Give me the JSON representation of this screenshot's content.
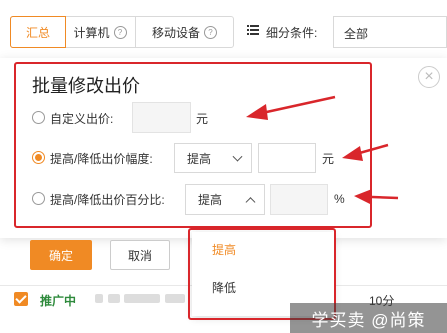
{
  "tabs": [
    {
      "label": "汇总",
      "active": true,
      "help": false
    },
    {
      "label": "计算机",
      "active": false,
      "help": true
    },
    {
      "label": "移动设备",
      "active": false,
      "help": true
    }
  ],
  "filter": {
    "label": "细分条件:",
    "value": "全部"
  },
  "dialog": {
    "title": "批量修改出价",
    "custom_bid": {
      "label": "自定义出价:",
      "value": "",
      "unit": "元",
      "selected": false
    },
    "adjust_amount": {
      "label": "提高/降低出价幅度:",
      "select_value": "提高",
      "value": "",
      "unit": "元",
      "selected": true
    },
    "adjust_percent": {
      "label": "提高/降低出价百分比:",
      "select_value": "提高",
      "value": "",
      "unit": "%",
      "selected": false
    },
    "ok_label": "确定",
    "cancel_label": "取消"
  },
  "dropdown": {
    "options": [
      "提高",
      "降低"
    ],
    "selected": "提高"
  },
  "table_row": {
    "status": "推广中",
    "score": "10分"
  },
  "watermark": "学买卖 @尚策",
  "colors": {
    "accent": "#f08a24",
    "highlight_red": "#d9262b",
    "status_green": "#2e8a3c"
  }
}
